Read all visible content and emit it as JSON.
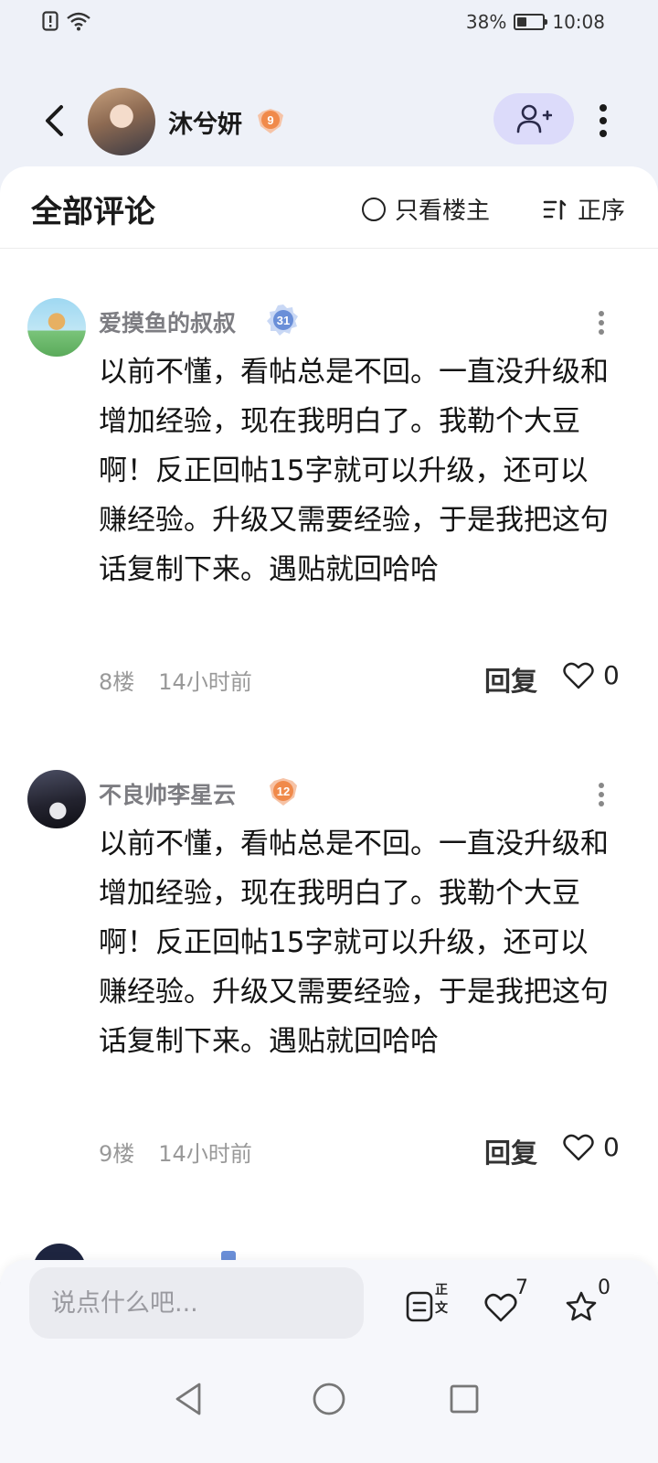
{
  "status_bar": {
    "battery_percent": "38%",
    "battery_level": 0.38,
    "time": "10:08"
  },
  "header": {
    "username": "沐兮妍",
    "level": "9"
  },
  "comments_header": {
    "title": "全部评论",
    "filter_label": "只看楼主",
    "sort_label": "正序"
  },
  "comments": [
    {
      "username": "爱摸鱼的叔叔",
      "level": "31",
      "text": "以前不懂，看帖总是不回。一直没升级和增加经验，现在我明白了。我勒个大豆啊！反正回帖15字就可以升级，还可以赚经验。升级又需要经验，于是我把这句话复制下来。遇贴就回哈哈",
      "floor": "8楼",
      "time": "14小时前",
      "reply_label": "回复",
      "likes": "0"
    },
    {
      "username": "不良帅李星云",
      "level": "12",
      "text": "以前不懂，看帖总是不回。一直没升级和增加经验，现在我明白了。我勒个大豆啊！反正回帖15字就可以升级，还可以赚经验。升级又需要经验，于是我把这句话复制下来。遇贴就回哈哈",
      "floor": "9楼",
      "time": "14小时前",
      "reply_label": "回复",
      "likes": "0"
    }
  ],
  "bottom_bar": {
    "input_placeholder": "说点什么吧...",
    "post_label": "正文",
    "like_count": "7",
    "favorite_count": "0"
  },
  "colors": {
    "accent_follow_bg": "#dcdbfa",
    "badge_orange": "#f08a4b",
    "badge_blue": "#6a8fd8"
  }
}
